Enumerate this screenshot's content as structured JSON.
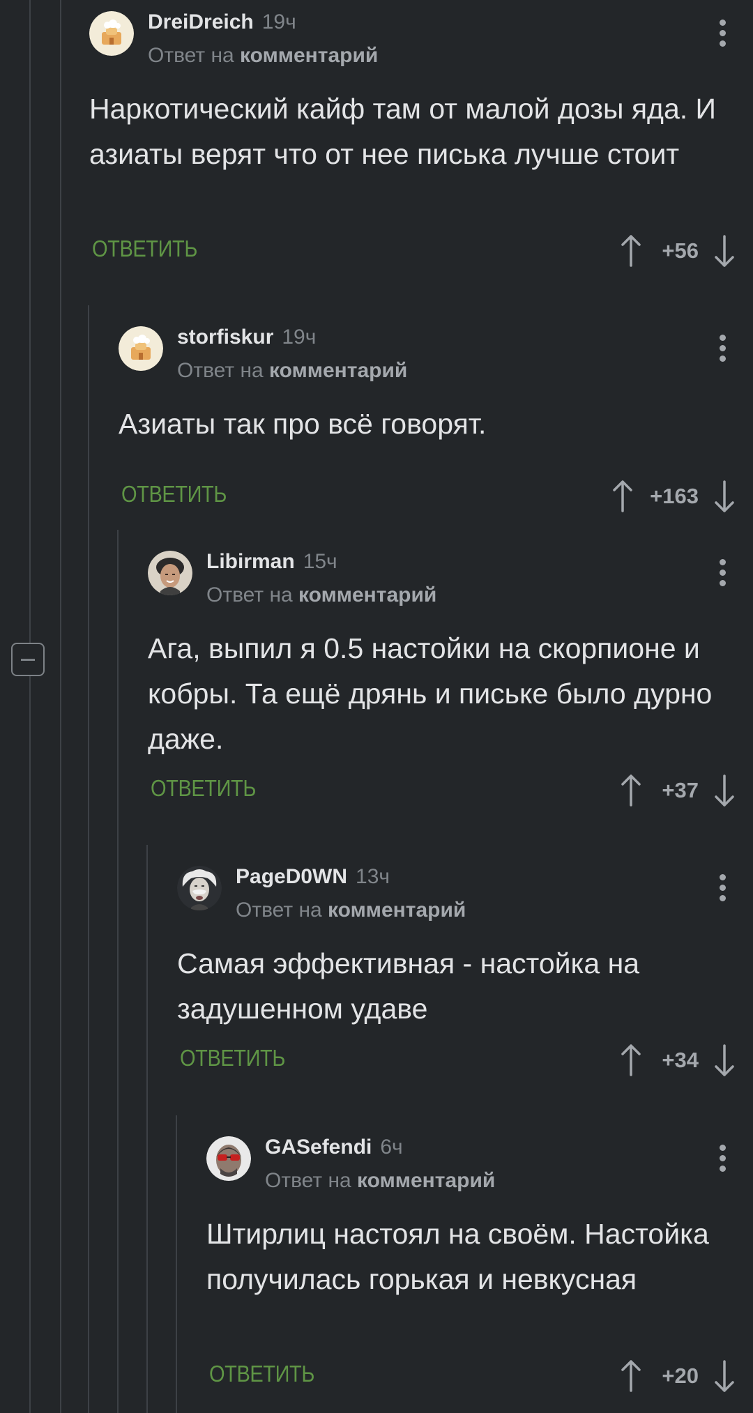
{
  "comments": [
    {
      "author": "DreiDreich",
      "time": "19ч",
      "reply_prefix": "Ответ на",
      "reply_link": "комментарий",
      "text": "Наркотический кайф там от малой дозы яда. И азиаты верят что от нее писька лучше стоит",
      "reply_label": "ОТВЕТИТЬ",
      "score": "+56",
      "avatar": "default-avatar-icon"
    },
    {
      "author": "storfiskur",
      "time": "19ч",
      "reply_prefix": "Ответ на",
      "reply_link": "комментарий",
      "text": "Азиаты так про всё говорят.",
      "reply_label": "ОТВЕТИТЬ",
      "score": "+163",
      "avatar": "default-avatar-icon"
    },
    {
      "author": "Libirman",
      "time": "15ч",
      "reply_prefix": "Ответ на",
      "reply_link": "комментарий",
      "text": "Ага, выпил я 0.5 настойки на скорпионе и кобры. Та ещё дрянь и письке было дурно даже.",
      "reply_label": "ОТВЕТИТЬ",
      "score": "+37",
      "avatar": "user-photo-avatar"
    },
    {
      "author": "PageD0WN",
      "time": "13ч",
      "reply_prefix": "Ответ на",
      "reply_link": "комментарий",
      "text": "Самая эффективная - настойка на задушенном удаве",
      "reply_label": "ОТВЕТИТЬ",
      "score": "+34",
      "avatar": "einstein-avatar"
    },
    {
      "author": "GASefendi",
      "time": "6ч",
      "reply_prefix": "Ответ на",
      "reply_link": "комментарий",
      "text": "Штирлиц настоял на своём. Настойка получилась горькая и невкусная",
      "reply_label": "ОТВЕТИТЬ",
      "score": "+20",
      "avatar": "sunglasses-avatar"
    }
  ],
  "colors": {
    "background": "#232629",
    "reply_green": "#5f9545",
    "muted": "#80858a",
    "text": "#e3e4e6",
    "thread_line": "#3d4146"
  }
}
